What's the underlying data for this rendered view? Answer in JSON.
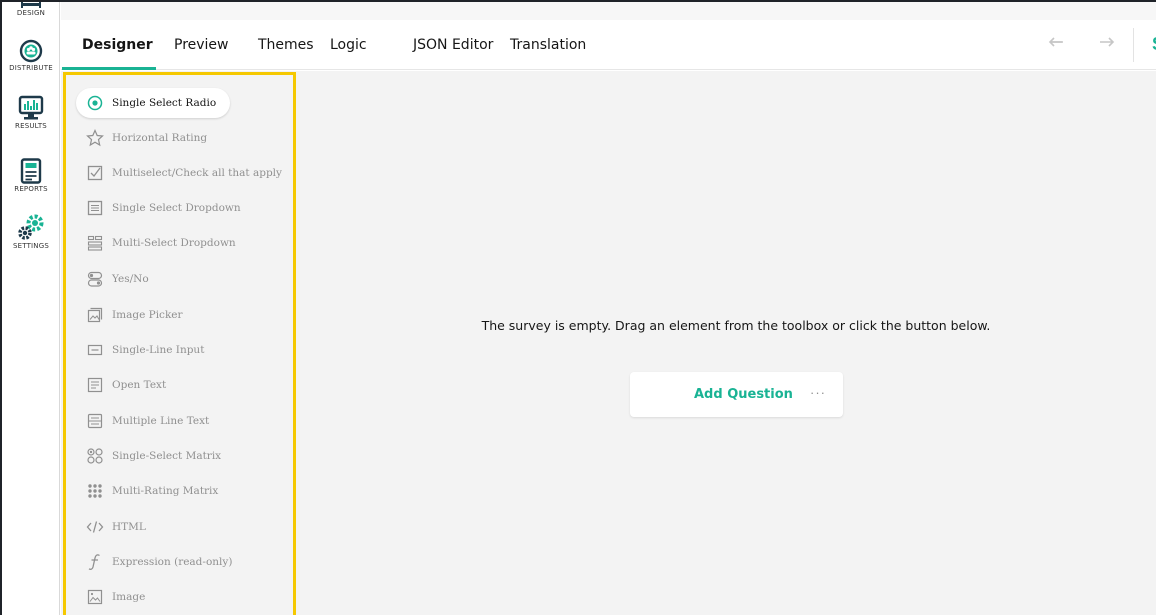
{
  "app_nav": {
    "items": [
      {
        "label": "DESIGN",
        "icon": "design-icon"
      },
      {
        "label": "DISTRIBUTE",
        "icon": "distribute-icon"
      },
      {
        "label": "RESULTS",
        "icon": "results-icon"
      },
      {
        "label": "REPORTS",
        "icon": "reports-icon"
      },
      {
        "label": "SETTINGS",
        "icon": "settings-icon"
      }
    ]
  },
  "tabs": [
    {
      "label": "Designer",
      "active": true
    },
    {
      "label": "Preview"
    },
    {
      "label": "Themes"
    },
    {
      "label": "Logic"
    },
    {
      "label": "JSON Editor"
    },
    {
      "label": "Translation"
    }
  ],
  "toolbar": {
    "undo_icon": "undo-icon",
    "redo_icon": "redo-icon",
    "overflow_glyph": "S"
  },
  "toolbox": {
    "items": [
      {
        "label": "Single Select Radio",
        "icon": "radio-icon"
      },
      {
        "label": "Horizontal Rating",
        "icon": "star-icon"
      },
      {
        "label": "Multiselect/Check all that apply",
        "icon": "checkbox-icon"
      },
      {
        "label": "Single Select Dropdown",
        "icon": "dropdown-icon"
      },
      {
        "label": "Multi-Select Dropdown",
        "icon": "tagbox-icon"
      },
      {
        "label": "Yes/No",
        "icon": "toggle-icon"
      },
      {
        "label": "Image Picker",
        "icon": "image-picker-icon"
      },
      {
        "label": "Single-Line Input",
        "icon": "text-input-icon"
      },
      {
        "label": "Open Text",
        "icon": "comment-icon"
      },
      {
        "label": "Multiple Line Text",
        "icon": "multiple-text-icon"
      },
      {
        "label": "Single-Select Matrix",
        "icon": "matrix-icon"
      },
      {
        "label": "Multi-Rating Matrix",
        "icon": "matrix-dropdown-icon"
      },
      {
        "label": "HTML",
        "icon": "html-icon"
      },
      {
        "label": "Expression (read-only)",
        "icon": "expression-icon"
      },
      {
        "label": "Image",
        "icon": "image-icon"
      }
    ]
  },
  "canvas": {
    "empty_message": "The survey is empty. Drag an element from the toolbox or click the button below.",
    "add_question_label": "Add Question",
    "more_label": "···"
  },
  "colors": {
    "accent": "#19b394",
    "highlight_border": "#f5c800",
    "nav_icon": "#1e3a4a"
  }
}
